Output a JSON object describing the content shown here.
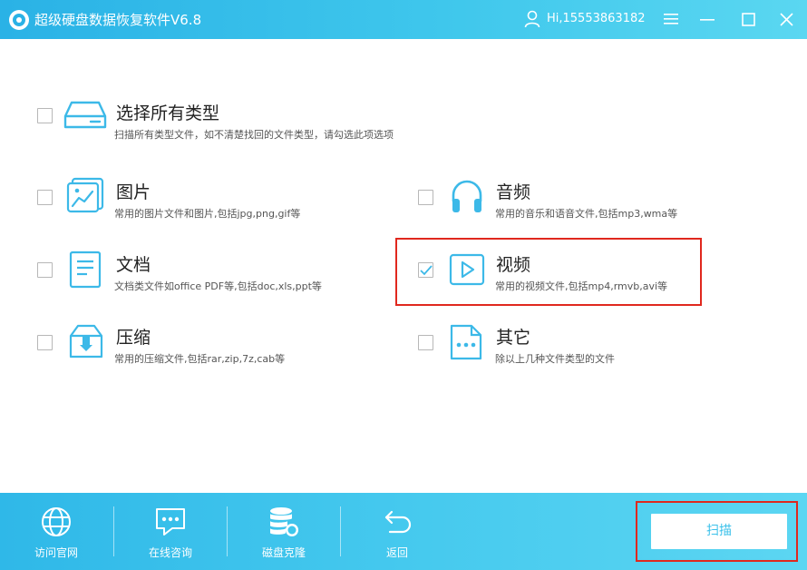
{
  "app": {
    "title": "超级硬盘数据恢复软件V6.8",
    "user": "Hi,15553863182"
  },
  "options": [
    {
      "key": "all",
      "title": "选择所有类型",
      "desc": "扫描所有类型文件，如不清楚找回的文件类型，请勾选此项选项",
      "checked": false
    },
    {
      "key": "image",
      "title": "图片",
      "desc": "常用的图片文件和图片,包括jpg,png,gif等",
      "checked": false
    },
    {
      "key": "audio",
      "title": "音频",
      "desc": "常用的音乐和语音文件,包括mp3,wma等",
      "checked": false
    },
    {
      "key": "document",
      "title": "文档",
      "desc": "文档类文件如office PDF等,包括doc,xls,ppt等",
      "checked": false
    },
    {
      "key": "video",
      "title": "视频",
      "desc": "常用的视频文件,包括mp4,rmvb,avi等",
      "checked": true
    },
    {
      "key": "archive",
      "title": "压缩",
      "desc": "常用的压缩文件,包括rar,zip,7z,cab等",
      "checked": false
    },
    {
      "key": "other",
      "title": "其它",
      "desc": "除以上几种文件类型的文件",
      "checked": false
    }
  ],
  "toolbar": {
    "website": "访问官网",
    "consult": "在线咨询",
    "clone": "磁盘克隆",
    "back": "返回"
  },
  "scan_label": "扫描",
  "colors": {
    "accent": "#3fc7ec",
    "icon": "#3cb9e8",
    "highlight": "#e0281e"
  }
}
